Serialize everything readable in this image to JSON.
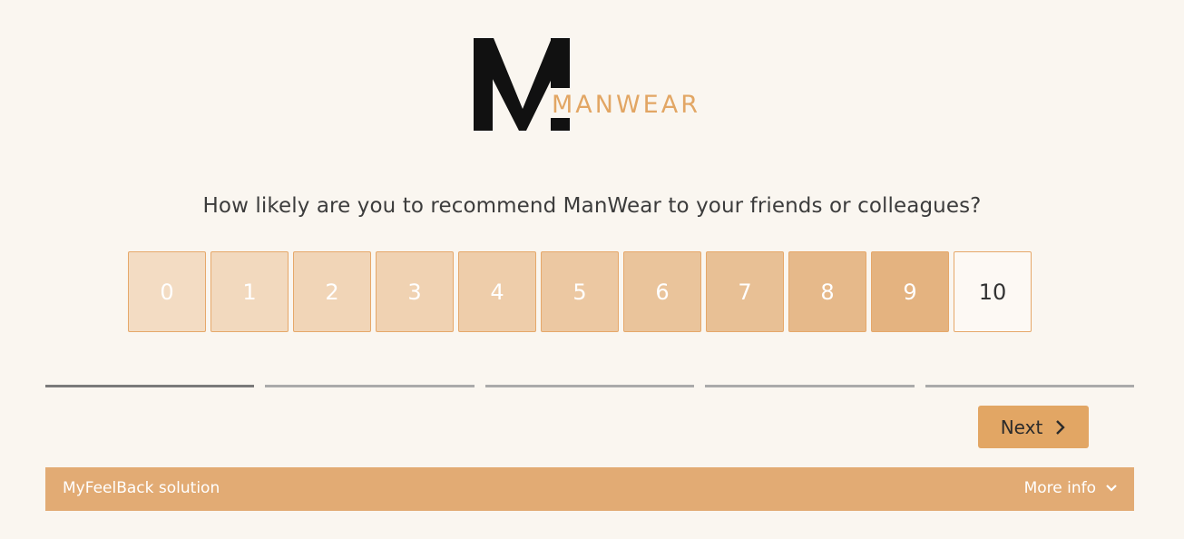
{
  "logo": {
    "mark": "M",
    "wordmark": "MANWEAR",
    "accent_color": "#e2a664"
  },
  "question": {
    "text": "How likely are you to recommend ManWear to your friends or colleagues?"
  },
  "scale": {
    "options": [
      {
        "label": "0",
        "color": "#f3dcc3"
      },
      {
        "label": "1",
        "color": "#f2d9be"
      },
      {
        "label": "2",
        "color": "#f1d5b7"
      },
      {
        "label": "3",
        "color": "#f0d2b2"
      },
      {
        "label": "4",
        "color": "#eecdaa"
      },
      {
        "label": "5",
        "color": "#ecc8a2"
      },
      {
        "label": "6",
        "color": "#eac49b"
      },
      {
        "label": "7",
        "color": "#e8c095"
      },
      {
        "label": "8",
        "color": "#e6b98a"
      },
      {
        "label": "9",
        "color": "#e4b380"
      },
      {
        "label": "10",
        "color": "#fdf9f4"
      }
    ],
    "border_color": "#e6a86a"
  },
  "progress": {
    "total_steps": 5,
    "current_step": 1
  },
  "navigation": {
    "next_label": "Next",
    "next_icon": "chevron-right-icon"
  },
  "footer": {
    "left_text": "MyFeelBack solution",
    "right_text": "More info",
    "right_icon": "chevron-down-icon",
    "background": "#e2ab74"
  }
}
